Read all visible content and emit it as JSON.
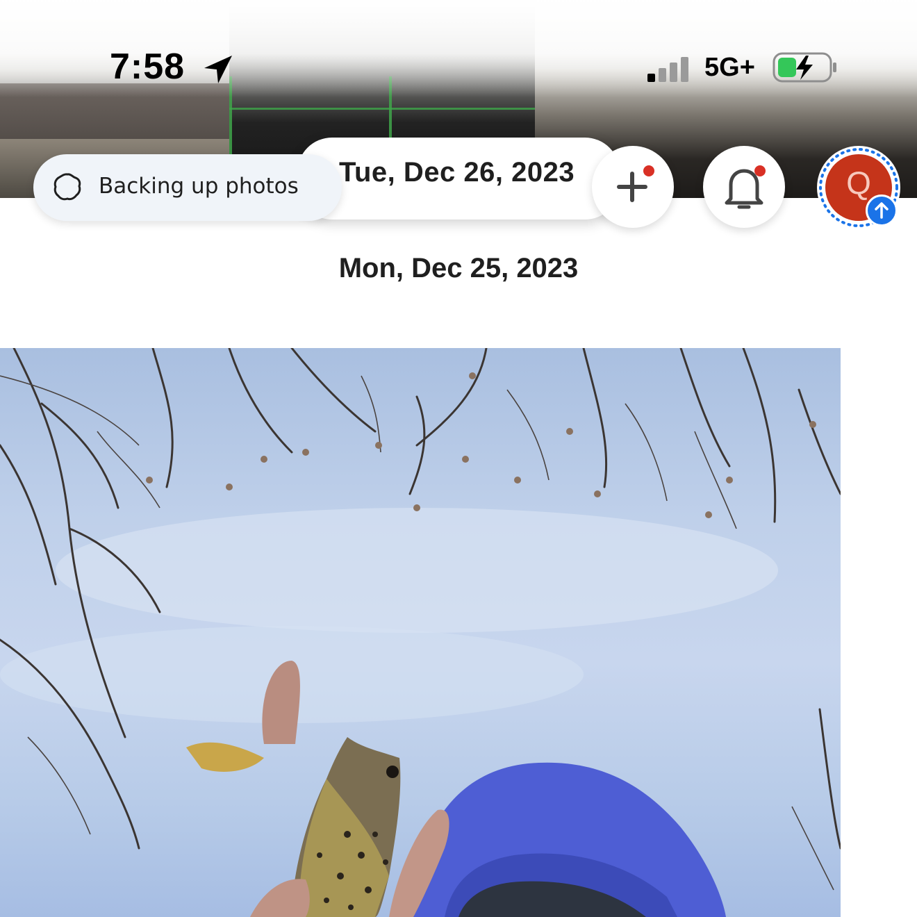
{
  "status_bar": {
    "time": "7:58",
    "network": "5G+",
    "icons": [
      "location-arrow-icon",
      "cellular-signal-icon",
      "battery-charging-icon"
    ]
  },
  "header": {
    "backup_status": "Backing up photos",
    "current_date": "Tue, Dec 26, 2023",
    "avatar_letter": "Q",
    "icons": [
      "backup-progress-icon",
      "plus-icon",
      "bell-icon",
      "upload-arrow-icon"
    ]
  },
  "timeline": {
    "section_date": "Mon, Dec 25, 2023"
  },
  "colors": {
    "avatar": "#c5341a",
    "notification_dot": "#d93025",
    "upload_badge": "#1a73e8",
    "battery_fill": "#34c759"
  }
}
